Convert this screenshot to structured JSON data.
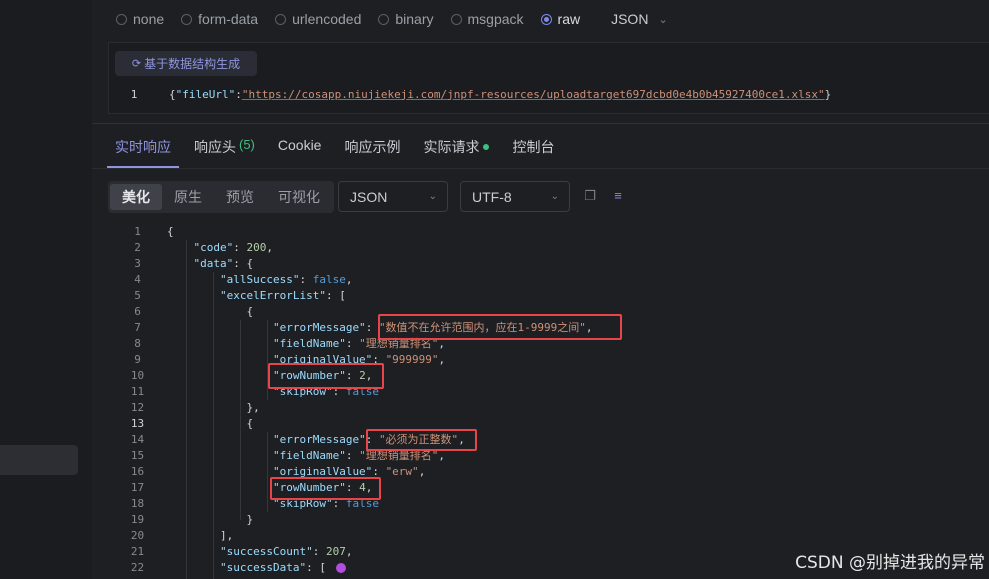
{
  "body_types": [
    {
      "label": "none",
      "checked": false
    },
    {
      "label": "form-data",
      "checked": false
    },
    {
      "label": "urlencoded",
      "checked": false
    },
    {
      "label": "binary",
      "checked": false
    },
    {
      "label": "msgpack",
      "checked": false
    },
    {
      "label": "raw",
      "checked": true
    }
  ],
  "raw_format": "JSON",
  "request": {
    "generate_button": "基于数据结构生成",
    "line_number": "1",
    "line_open": "{",
    "key": "\"fileUrl\"",
    "colon": ":",
    "value": "\"https://cosapp.niujiekeji.com/jnpf-resources/uploadtarget697dcbd0e4b0b45927400ce1.xlsx\"",
    "line_close": "}"
  },
  "response_tabs": {
    "realtime": "实时响应",
    "headers": "响应头",
    "headers_count": "(5)",
    "cookie": "Cookie",
    "example": "响应示例",
    "actual_request": "实际请求",
    "console": "控制台"
  },
  "view_modes": {
    "pretty": "美化",
    "raw": "原生",
    "preview": "预览",
    "visualize": "可视化"
  },
  "format_select": "JSON",
  "encoding_select": "UTF-8",
  "icons": [
    "radio-icon",
    "refresh-icon",
    "chevron-down-icon",
    "copy-icon",
    "wrap-icon"
  ],
  "colors": {
    "accent": "#8f95de",
    "highlight_box": "#e8454a",
    "status_dot": "#3fbf7f"
  },
  "response_lines": [
    {
      "n": "1",
      "t": [
        [
          "p",
          "{"
        ]
      ]
    },
    {
      "n": "2",
      "t": [
        [
          "p",
          "    "
        ],
        [
          "k",
          "\"code\""
        ],
        [
          "p",
          ": "
        ],
        [
          "n",
          "200"
        ],
        [
          "p",
          ","
        ]
      ]
    },
    {
      "n": "3",
      "t": [
        [
          "p",
          "    "
        ],
        [
          "k",
          "\"data\""
        ],
        [
          "p",
          ": {"
        ]
      ]
    },
    {
      "n": "4",
      "t": [
        [
          "p",
          "        "
        ],
        [
          "k",
          "\"allSuccess\""
        ],
        [
          "p",
          ": "
        ],
        [
          "b",
          "false"
        ],
        [
          "p",
          ","
        ]
      ]
    },
    {
      "n": "5",
      "t": [
        [
          "p",
          "        "
        ],
        [
          "k",
          "\"excelErrorList\""
        ],
        [
          "p",
          ": ["
        ]
      ]
    },
    {
      "n": "6",
      "t": [
        [
          "p",
          "            {"
        ]
      ]
    },
    {
      "n": "7",
      "t": [
        [
          "p",
          "                "
        ],
        [
          "k",
          "\"errorMessage\""
        ],
        [
          "p",
          ": "
        ],
        [
          "s",
          "\"数值不在允许范围内，应在1-9999之间\""
        ],
        [
          "p",
          ","
        ]
      ]
    },
    {
      "n": "8",
      "t": [
        [
          "p",
          "                "
        ],
        [
          "k",
          "\"fieldName\""
        ],
        [
          "p",
          ": "
        ],
        [
          "s",
          "\"理想销量排名\""
        ],
        [
          "p",
          ","
        ]
      ]
    },
    {
      "n": "9",
      "t": [
        [
          "p",
          "                "
        ],
        [
          "k",
          "\"originalValue\""
        ],
        [
          "p",
          ": "
        ],
        [
          "s",
          "\"999999\""
        ],
        [
          "p",
          ","
        ]
      ]
    },
    {
      "n": "10",
      "t": [
        [
          "p",
          "                "
        ],
        [
          "k",
          "\"rowNumber\""
        ],
        [
          "p",
          ": "
        ],
        [
          "n",
          "2"
        ],
        [
          "p",
          ","
        ]
      ]
    },
    {
      "n": "11",
      "t": [
        [
          "p",
          "                "
        ],
        [
          "k",
          "\"skipRow\""
        ],
        [
          "p",
          ": "
        ],
        [
          "b",
          "false"
        ]
      ]
    },
    {
      "n": "12",
      "t": [
        [
          "p",
          "            },"
        ]
      ]
    },
    {
      "n": "13",
      "cur": true,
      "t": [
        [
          "p",
          "            {"
        ]
      ]
    },
    {
      "n": "14",
      "t": [
        [
          "p",
          "                "
        ],
        [
          "k",
          "\"errorMessage\""
        ],
        [
          "p",
          ": "
        ],
        [
          "s",
          "\"必须为正整数\""
        ],
        [
          "p",
          ","
        ]
      ]
    },
    {
      "n": "15",
      "t": [
        [
          "p",
          "                "
        ],
        [
          "k",
          "\"fieldName\""
        ],
        [
          "p",
          ": "
        ],
        [
          "s",
          "\"理想销量排名\""
        ],
        [
          "p",
          ","
        ]
      ]
    },
    {
      "n": "16",
      "t": [
        [
          "p",
          "                "
        ],
        [
          "k",
          "\"originalValue\""
        ],
        [
          "p",
          ": "
        ],
        [
          "s",
          "\"erw\""
        ],
        [
          "p",
          ","
        ]
      ]
    },
    {
      "n": "17",
      "t": [
        [
          "p",
          "                "
        ],
        [
          "k",
          "\"rowNumber\""
        ],
        [
          "p",
          ": "
        ],
        [
          "n",
          "4"
        ],
        [
          "p",
          ","
        ]
      ]
    },
    {
      "n": "18",
      "t": [
        [
          "p",
          "                "
        ],
        [
          "k",
          "\"skipRow\""
        ],
        [
          "p",
          ": "
        ],
        [
          "b",
          "false"
        ]
      ]
    },
    {
      "n": "19",
      "t": [
        [
          "p",
          "            }"
        ]
      ]
    },
    {
      "n": "20",
      "t": [
        [
          "p",
          "        ],"
        ]
      ]
    },
    {
      "n": "21",
      "t": [
        [
          "p",
          "        "
        ],
        [
          "k",
          "\"successCount\""
        ],
        [
          "p",
          ": "
        ],
        [
          "n",
          "207"
        ],
        [
          "p",
          ","
        ]
      ]
    },
    {
      "n": "22",
      "t": [
        [
          "p",
          "        "
        ],
        [
          "k",
          "\"successData\""
        ],
        [
          "p",
          ": ["
        ]
      ]
    }
  ],
  "watermark": "CSDN @别掉进我的异常"
}
